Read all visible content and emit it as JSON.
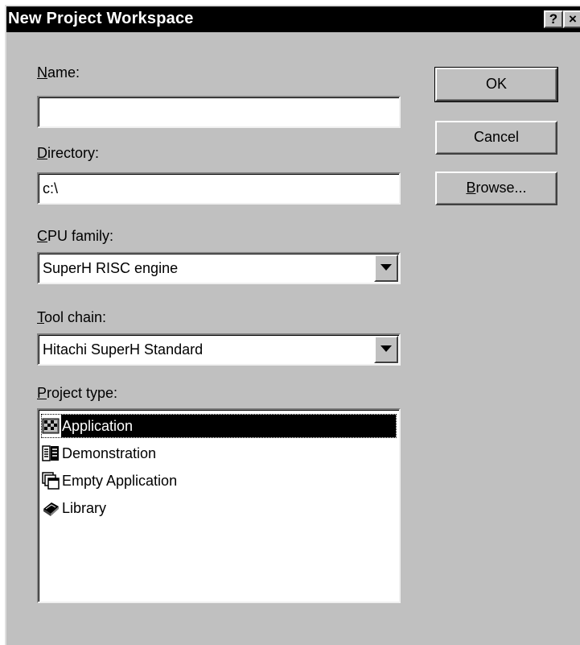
{
  "window": {
    "title": "New Project Workspace",
    "help_glyph": "?",
    "close_glyph": "×"
  },
  "name": {
    "label_mnemonic": "N",
    "label_rest": "ame:",
    "value": ""
  },
  "directory": {
    "label_mnemonic": "D",
    "label_rest": "irectory:",
    "value": "c:\\"
  },
  "cpu_family": {
    "label_mnemonic": "C",
    "label_rest": "PU family:",
    "selected": "SuperH RISC engine"
  },
  "tool_chain": {
    "label_mnemonic": "T",
    "label_rest": "ool chain:",
    "selected": "Hitachi SuperH Standard"
  },
  "project_type": {
    "label_mnemonic": "P",
    "label_rest": "roject type:",
    "items": [
      {
        "label": "Application",
        "icon": "application-icon",
        "selected": true
      },
      {
        "label": "Demonstration",
        "icon": "demonstration-icon",
        "selected": false
      },
      {
        "label": "Empty Application",
        "icon": "empty-application-icon",
        "selected": false
      },
      {
        "label": "Library",
        "icon": "library-icon",
        "selected": false
      }
    ]
  },
  "buttons": {
    "ok": "OK",
    "cancel": "Cancel",
    "browse_mnemonic": "B",
    "browse_rest": "rowse..."
  },
  "colors": {
    "face": "#c0c0c0",
    "titlebar": "#000000",
    "selection": "#000000"
  }
}
